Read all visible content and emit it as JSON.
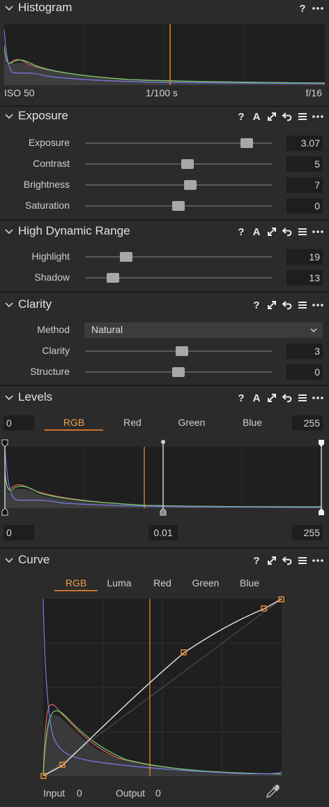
{
  "histogram": {
    "title": "Histogram",
    "iso": "ISO 50",
    "shutter": "1/100 s",
    "aperture": "f/16"
  },
  "exposure": {
    "title": "Exposure",
    "sliders": [
      {
        "label": "Exposure",
        "value": "3.07",
        "fraction": 0.865
      },
      {
        "label": "Contrast",
        "value": "5",
        "fraction": 0.55
      },
      {
        "label": "Brightness",
        "value": "7",
        "fraction": 0.565
      },
      {
        "label": "Saturation",
        "value": "0",
        "fraction": 0.5
      }
    ]
  },
  "hdr": {
    "title": "High Dynamic Range",
    "sliders": [
      {
        "label": "Highlight",
        "value": "19",
        "fraction": 0.22
      },
      {
        "label": "Shadow",
        "value": "13",
        "fraction": 0.15
      }
    ]
  },
  "clarity": {
    "title": "Clarity",
    "method_label": "Method",
    "method_value": "Natural",
    "sliders": [
      {
        "label": "Clarity",
        "value": "3",
        "fraction": 0.52
      },
      {
        "label": "Structure",
        "value": "0",
        "fraction": 0.5
      }
    ]
  },
  "levels": {
    "title": "Levels",
    "input_low": "0",
    "input_high": "255",
    "tabs": [
      "RGB",
      "Red",
      "Green",
      "Blue"
    ],
    "active_tab": "RGB",
    "output_low": "0",
    "midtone": "0.01",
    "output_high": "255"
  },
  "curve": {
    "title": "Curve",
    "tabs": [
      "RGB",
      "Luma",
      "Red",
      "Green",
      "Blue"
    ],
    "active_tab": "RGB",
    "input_label": "Input",
    "input_value": "0",
    "output_label": "Output",
    "output_value": "0"
  },
  "colors": {
    "accent": "#d07028",
    "background": "#2b2b2b",
    "field": "#1e1e1e"
  }
}
